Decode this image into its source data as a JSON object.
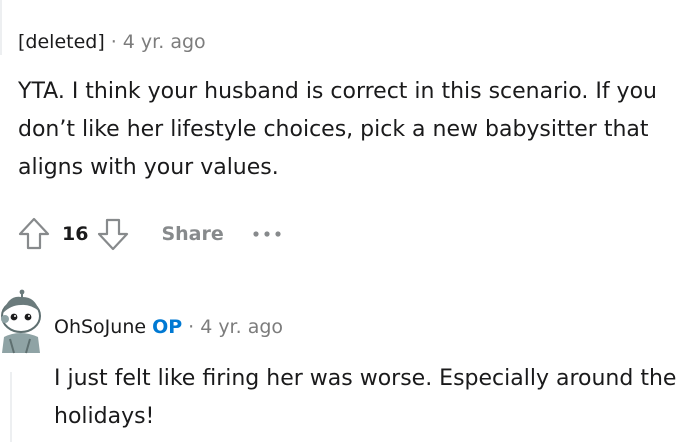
{
  "comment": {
    "author": "[deleted]",
    "separator": "·",
    "time": "4 yr. ago",
    "body": "YTA. I think your husband is correct in this scenario. If you don’t like her lifestyle choices, pick a new babysitter that aligns with your values.",
    "score": "16",
    "share_label": "Share",
    "icons": {
      "upvote": "upvote-arrow-icon",
      "downvote": "downvote-arrow-icon",
      "more": "more-options-icon"
    }
  },
  "reply": {
    "author": "OhSoJune",
    "op_badge": "OP",
    "separator": "·",
    "time": "4 yr. ago",
    "body": "I just felt like firing her was worse. Especially around the holidays!",
    "avatar_icon": "user-avatar-icon"
  },
  "colors": {
    "text": "#1a1a1b",
    "meta": "#7c7c7c",
    "icon": "#878a8c",
    "op": "#0079d3"
  }
}
